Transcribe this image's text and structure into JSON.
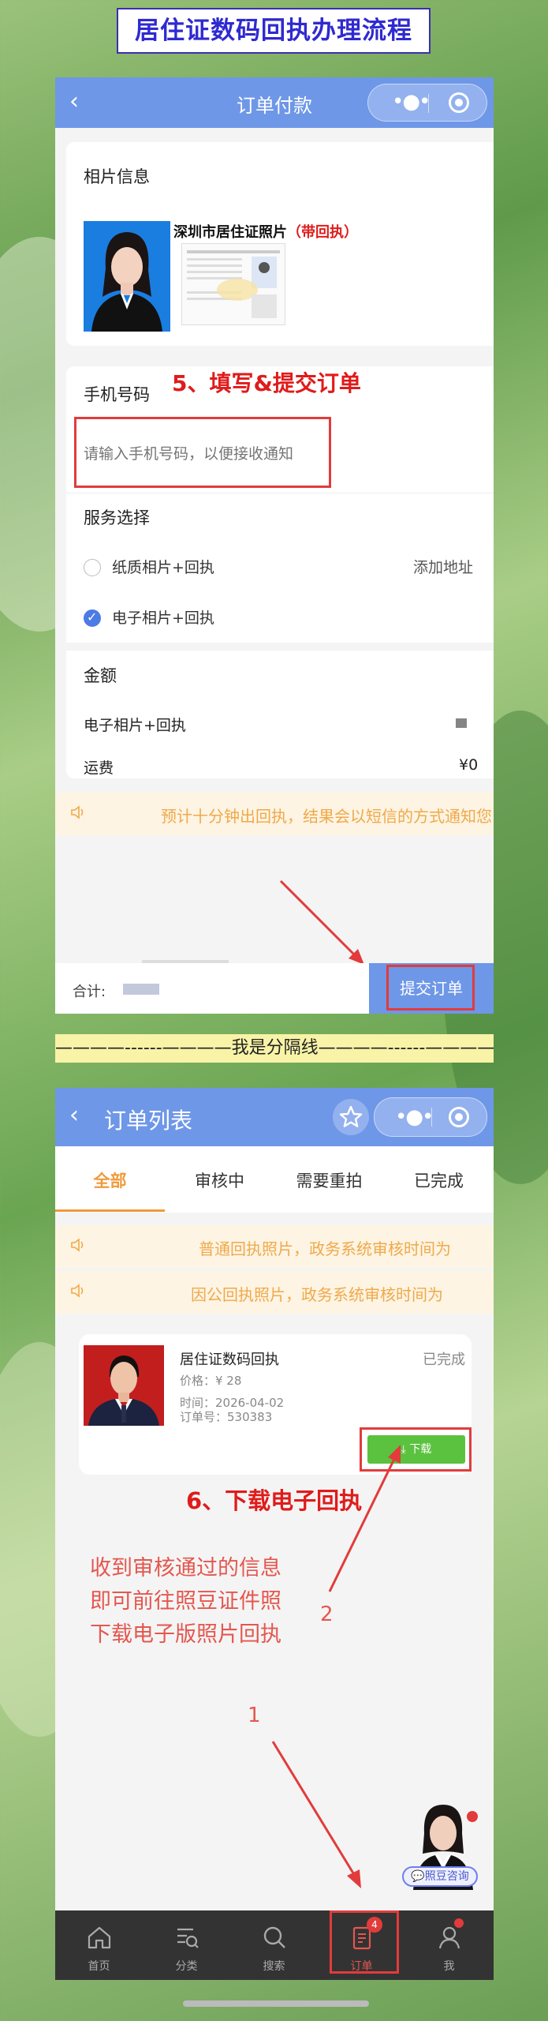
{
  "header": {
    "title": "居住证数码回执办理流程"
  },
  "order_pay": {
    "nav_back": "‹",
    "nav_title": "订单付款",
    "photo_info_label": "相片信息",
    "product_name": "深圳市居住证照片",
    "product_tag": "（带回执）",
    "step5_label": "5、填写&提交订单",
    "phone_label": "手机号码",
    "phone_placeholder": "请输入手机号码，以便接收通知",
    "service_label": "服务选择",
    "service_options": [
      {
        "label": "纸质相片+回执",
        "selected": false
      },
      {
        "label": "电子相片+回执",
        "selected": true
      }
    ],
    "add_address": "添加地址",
    "amount_label": "金额",
    "amount_rows": [
      {
        "label": "电子相片+回执",
        "value": ""
      },
      {
        "label": "运费",
        "value": "¥0"
      }
    ],
    "notice": "预计十分钟出回执，结果会以短信的方式通知您",
    "total_label": "合计:",
    "submit_button": "提交订单"
  },
  "divider_text": "————------————我是分隔线————------————",
  "order_list": {
    "nav_back": "‹",
    "nav_title": "订单列表",
    "tabs": [
      {
        "label": "全部",
        "active": true
      },
      {
        "label": "审核中",
        "active": false
      },
      {
        "label": "需要重拍",
        "active": false
      },
      {
        "label": "已完成",
        "active": false
      }
    ],
    "notices": [
      "普通回执照片，政务系统审核时间为",
      "因公回执照片，政务系统审核时间为"
    ],
    "order": {
      "title": "居住证数码回执",
      "status": "已完成",
      "price": "价格：¥ 28",
      "time": "时间：2026-04-02",
      "order_no": "订单号：530383",
      "download_label": "下载"
    },
    "step6_label": "6、下载电子回执",
    "instruction": "收到审核通过的信息\n即可前往照豆证件照\n下载电子版照片回执",
    "anno_1": "1",
    "anno_2": "2",
    "consult_label": "照豆咨询",
    "tabbar": [
      {
        "label": "首页",
        "icon": "home-icon"
      },
      {
        "label": "分类",
        "icon": "category-icon"
      },
      {
        "label": "搜索",
        "icon": "search-icon"
      },
      {
        "label": "订单",
        "icon": "order-icon",
        "badge": "4"
      },
      {
        "label": "我",
        "icon": "user-icon"
      }
    ]
  }
}
